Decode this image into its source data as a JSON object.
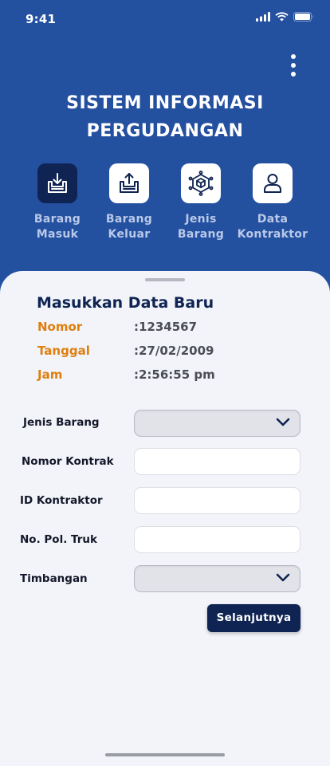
{
  "status_bar": {
    "time": "9:41"
  },
  "app": {
    "title_line1": "SISTEM INFORMASI",
    "title_line2": "PERGUDANGAN"
  },
  "nav": [
    {
      "label_line1": "Barang",
      "label_line2": "Masuk",
      "icon": "inbox-download-icon",
      "active": true
    },
    {
      "label_line1": "Barang",
      "label_line2": "Keluar",
      "icon": "inbox-upload-icon",
      "active": false
    },
    {
      "label_line1": "Jenis",
      "label_line2": "Barang",
      "icon": "cube-network-icon",
      "active": false
    },
    {
      "label_line1": "Data",
      "label_line2": "Kontraktor",
      "icon": "user-icon",
      "active": false
    }
  ],
  "sheet": {
    "title": "Masukkan Data Baru",
    "info": [
      {
        "label": "Nomor",
        "value": ":1234567"
      },
      {
        "label": "Tanggal",
        "value": ":27/02/2009"
      },
      {
        "label": "Jam",
        "value": ":2:56:55 pm"
      }
    ]
  },
  "form": {
    "jenis_barang": {
      "label": "Jenis Barang",
      "value": ""
    },
    "nomor_kontrak": {
      "label": "Nomor Kontrak",
      "value": ""
    },
    "id_kontraktor": {
      "label": "ID Kontraktor",
      "value": ""
    },
    "no_pol_truk": {
      "label": "No. Pol. Truk",
      "value": ""
    },
    "timbangan": {
      "label": "Timbangan",
      "value": ""
    },
    "next_label": "Selanjutnya"
  },
  "colors": {
    "header_bg": "#2450a0",
    "navy": "#0f2453",
    "accent_orange": "#e07e0e",
    "sheet_bg": "#f2f4f9"
  }
}
